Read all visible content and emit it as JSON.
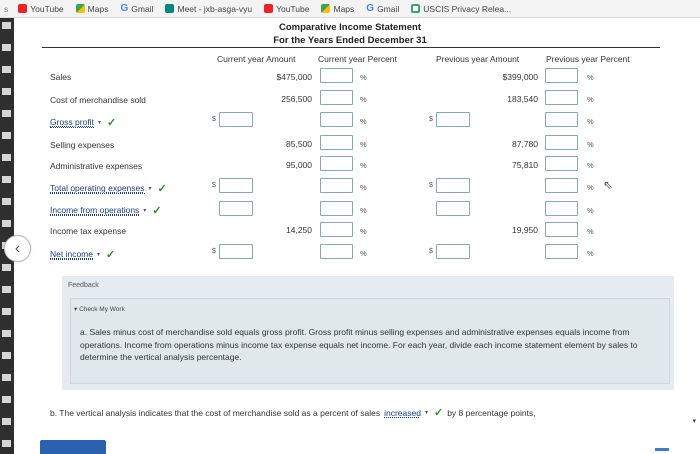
{
  "bookmarks": [
    {
      "label": "YouTube",
      "icon": "youtube-icon",
      "cls": "ic-yt"
    },
    {
      "label": "Maps",
      "icon": "maps-icon",
      "cls": "ic-maps"
    },
    {
      "label": "Gmail",
      "icon": "google-icon",
      "cls": "ic-g",
      "glyph": "G"
    },
    {
      "label": "Meet - jxb-asga-vyu",
      "icon": "meet-icon",
      "cls": "ic-meet"
    },
    {
      "label": "YouTube",
      "icon": "youtube-icon",
      "cls": "ic-yt"
    },
    {
      "label": "Maps",
      "icon": "maps-icon",
      "cls": "ic-maps"
    },
    {
      "label": "Gmail",
      "icon": "google-icon",
      "cls": "ic-g",
      "glyph": "G"
    },
    {
      "label": "USCIS Privacy Relea...",
      "icon": "uscis-icon",
      "cls": "ic-uscis"
    }
  ],
  "statement": {
    "title": "Comparative Income Statement",
    "subtitle": "For the Years Ended December 31"
  },
  "columns": {
    "current_amount": "Current year Amount",
    "current_percent": "Current year Percent",
    "previous_amount": "Previous year Amount",
    "previous_percent": "Previous year Percent"
  },
  "rows": {
    "sales": {
      "label": "Sales",
      "current": "$475,000",
      "previous": "$399,000"
    },
    "cogs": {
      "label": "Cost of merchandise sold",
      "current": "256,500",
      "previous": "183,540"
    },
    "gross_profit": {
      "label": "Gross profit"
    },
    "selling": {
      "label": "Selling expenses",
      "current": "85,500",
      "previous": "87,780"
    },
    "admin": {
      "label": "Administrative expenses",
      "current": "95,000",
      "previous": "75,810"
    },
    "total_opex": {
      "label": "Total operating expenses"
    },
    "income_ops": {
      "label": "Income from operations"
    },
    "tax": {
      "label": "Income tax expense",
      "current": "14,250",
      "previous": "19,950"
    },
    "net_income": {
      "label": "Net income"
    }
  },
  "symbols": {
    "percent": "%",
    "dollar": "$",
    "check": "✓",
    "caret": "▾"
  },
  "feedback": {
    "label": "Feedback",
    "check_my_work": "Check My Work",
    "text": "a. Sales minus cost of merchandise sold equals gross profit. Gross profit minus selling expenses and administrative expenses equals income from operations. Income from operations minus income tax expense equals net income. For each year, divide each income statement element by sales to determine the vertical analysis percentage."
  },
  "part_b": {
    "prefix": "b. The vertical analysis indicates that the cost of merchandise sold as a percent of sales",
    "selected": "increased",
    "suffix": "by 8 percentage points,"
  },
  "nav": {
    "prev_glyph": "‹"
  }
}
